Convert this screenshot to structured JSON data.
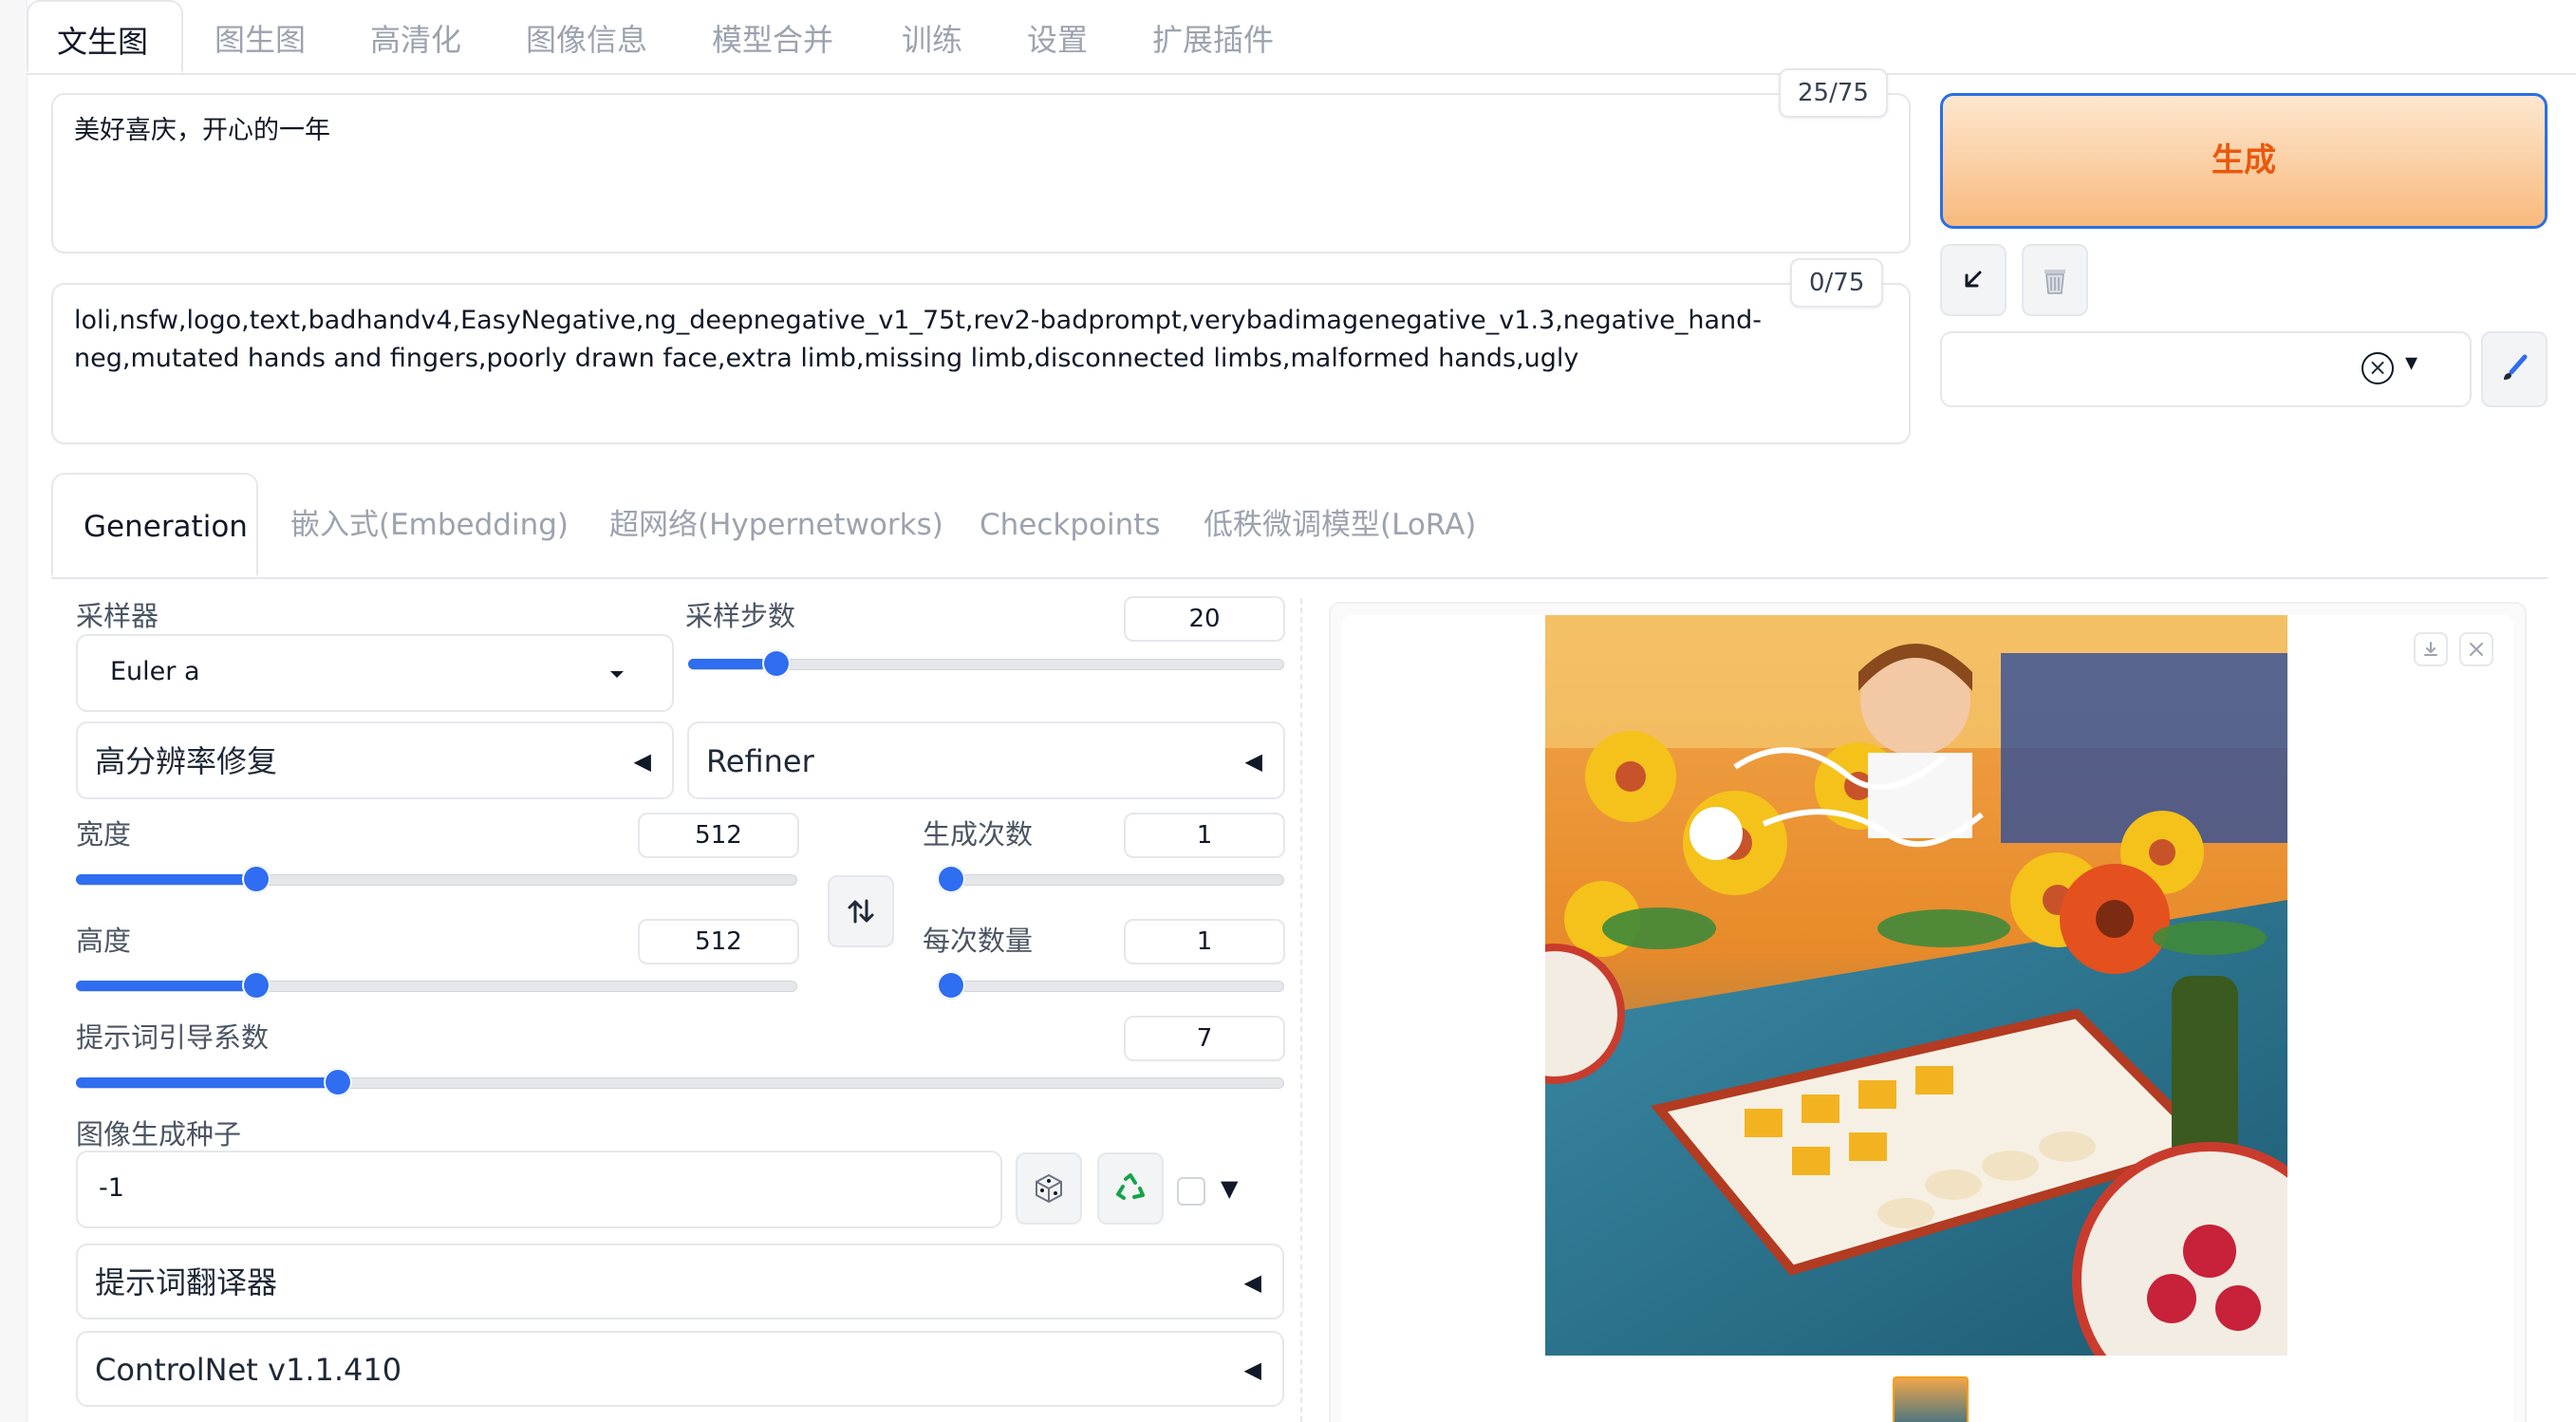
{
  "main_tabs": [
    "文生图",
    "图生图",
    "高清化",
    "图像信息",
    "模型合并",
    "训练",
    "设置",
    "扩展插件"
  ],
  "prompt": {
    "text": "美好喜庆，开心的一年",
    "counter": "25/75"
  },
  "negative_prompt": {
    "text": "loli,nsfw,logo,text,badhandv4,EasyNegative,ng_deepnegative_v1_75t,rev2-badprompt,verybadimagenegative_v1.3,negative_hand-neg,mutated hands and fingers,poorly drawn face,extra limb,missing limb,disconnected limbs,malformed hands,ugly",
    "counter": "0/75"
  },
  "generate_button": "生成",
  "style_select": {
    "clear_icon": "×",
    "caret": "▾"
  },
  "sub_tabs": [
    "Generation",
    "嵌入式(Embedding)",
    "超网络(Hypernetworks)",
    "Checkpoints",
    "低秩微调模型(LoRA)"
  ],
  "sampler": {
    "label": "采样器",
    "value": "Euler a"
  },
  "steps": {
    "label": "采样步数",
    "value": "20",
    "fraction": 0.13
  },
  "hires_fix": {
    "label": "高分辨率修复",
    "arrow": "◀"
  },
  "refiner": {
    "label": "Refiner",
    "arrow": "◀"
  },
  "width": {
    "label": "宽度",
    "value": "512",
    "fraction": 0.24
  },
  "height": {
    "label": "高度",
    "value": "512",
    "fraction": 0.24
  },
  "batch_count": {
    "label": "生成次数",
    "value": "1",
    "fraction": 0.0
  },
  "batch_size": {
    "label": "每次数量",
    "value": "1",
    "fraction": 0.0
  },
  "cfg_scale": {
    "label": "提示词引导系数",
    "value": "7",
    "fraction": 0.21
  },
  "seed": {
    "label": "图像生成种子",
    "value": "-1",
    "extra_arrow": "▼"
  },
  "prompt_translator": {
    "label": "提示词翻译器",
    "arrow": "◀"
  },
  "controlnet": {
    "label": "ControlNet v1.1.410",
    "arrow": "◀"
  },
  "colors": {
    "accent": "#2f6df1",
    "generate_text": "#ea580c",
    "generate_bg": "#f8b97d",
    "generate_border": "#2b6fe5"
  }
}
